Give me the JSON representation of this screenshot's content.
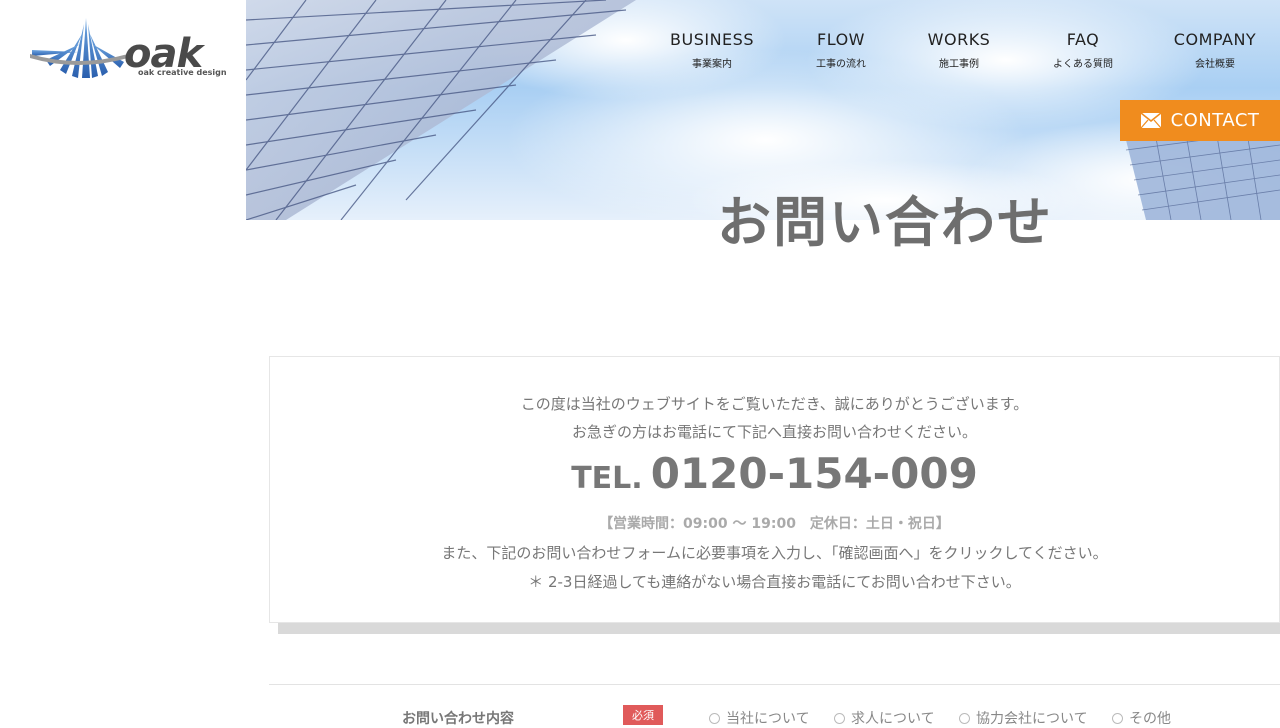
{
  "logo": {
    "wordmark": "oak",
    "tagline": "oak creative design"
  },
  "nav": {
    "items": [
      {
        "en": "BUSINESS",
        "ja": "事業案内"
      },
      {
        "en": "FLOW",
        "ja": "工事の流れ"
      },
      {
        "en": "WORKS",
        "ja": "施工事例"
      },
      {
        "en": "FAQ",
        "ja": "よくある質問"
      },
      {
        "en": "COMPANY",
        "ja": "会社概要"
      }
    ],
    "contact_label": "CONTACT"
  },
  "hero": {
    "title": "お問い合わせ"
  },
  "info": {
    "line1": "この度は当社のウェブサイトをご覧いただき、誠にありがとうございます。",
    "line2": "お急ぎの方はお電話にて下記へ直接お問い合わせください。",
    "tel_prefix": "TEL.",
    "tel_number": "0120-154-009",
    "hours": "【営業時間：09:00 ～ 19:00　定休日：土日・祝日】",
    "line3": "また、下記のお問い合わせフォームに必要事項を入力し、「確認画面へ」をクリックしてください。",
    "line4": "＊ 2-3日経過しても連絡がない場合直接お電話にてお問い合わせ下さい。"
  },
  "form": {
    "inquiry_label": "お問い合わせ内容",
    "required_badge": "必須",
    "options": [
      "当社について",
      "求人について",
      "協力会社について",
      "その他"
    ]
  },
  "colors": {
    "accent": "#f08c1e",
    "required": "#e05a5a",
    "title_gray": "#6e6e6e"
  }
}
